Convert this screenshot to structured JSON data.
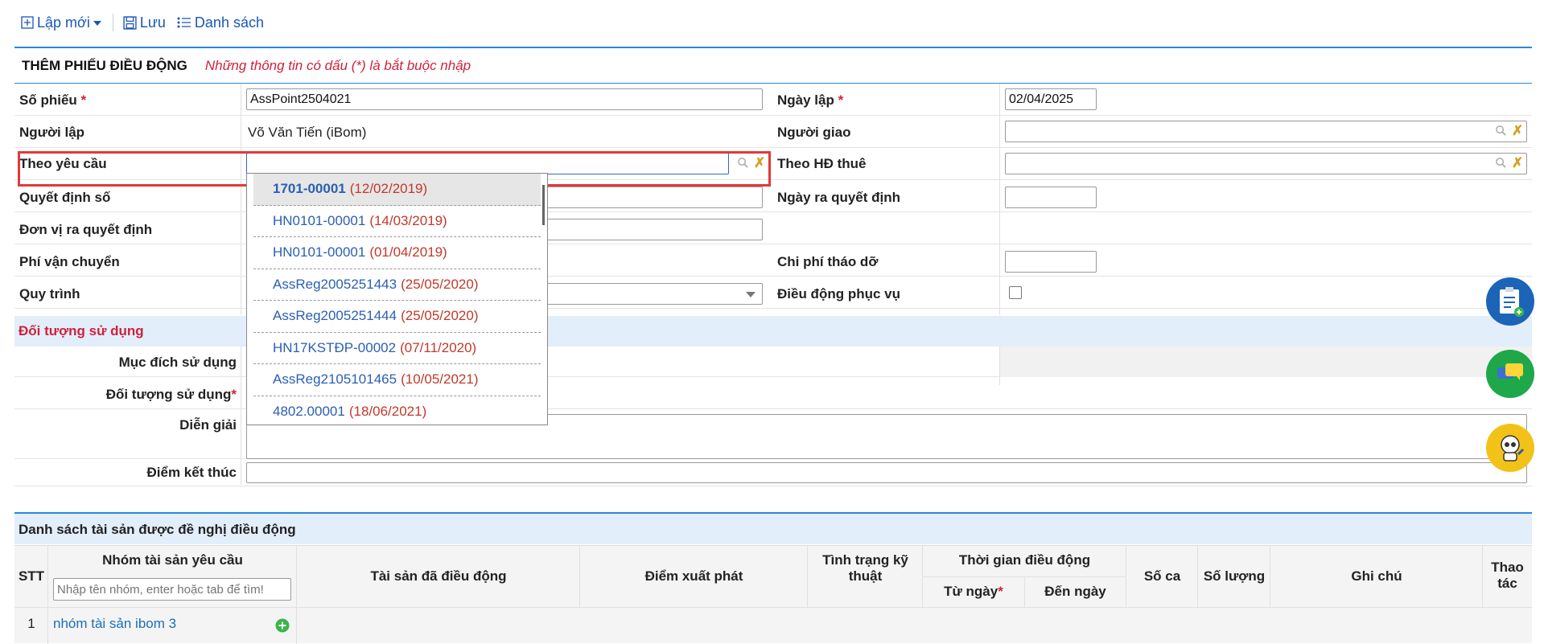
{
  "toolbar": {
    "new_label": "Lập mới",
    "save_label": "Lưu",
    "list_label": "Danh sách"
  },
  "form": {
    "title": "THÊM PHIẾU ĐIỀU ĐỘNG",
    "note": "Những thông tin có dấu (*) là bắt buộc nhập",
    "so_phieu_label": "Số phiếu",
    "so_phieu_value": "AssPoint2504021",
    "ngay_lap_label": "Ngày lập",
    "ngay_lap_value": "02/04/2025",
    "nguoi_lap_label": "Người lập",
    "nguoi_lap_value": "Võ Văn Tiến (iBom)",
    "nguoi_giao_label": "Người giao",
    "theo_yeu_cau_label": "Theo yêu cầu",
    "theo_hd_thue_label": "Theo HĐ thuê",
    "quyet_dinh_so_label": "Quyết định số",
    "ngay_ra_qd_label": "Ngày ra quyết định",
    "don_vi_label": "Đơn vị ra quyết định",
    "phi_van_chuyen_label": "Phí vận chuyển",
    "chi_phi_thao_do_label": "Chi phí tháo dỡ",
    "quy_trinh_label": "Quy trình",
    "dieu_dong_phuc_vu_label": "Điều động phục vụ",
    "required_mark": "*"
  },
  "section_doi_tuong": {
    "title": "Đối tượng sử dụng",
    "muc_dich_label": "Mục đích sử dụng",
    "doi_tuong_label": "Đối tượng sử dụng",
    "dien_giai_label": "Diễn giải",
    "diem_ket_thuc_label": "Điểm kết thúc"
  },
  "dropdown": {
    "items": [
      {
        "code": "1701-00001",
        "date": "(12/02/2019)"
      },
      {
        "code": "HN0101-00001",
        "date": "(14/03/2019)"
      },
      {
        "code": "HN0101-00001",
        "date": "(01/04/2019)"
      },
      {
        "code": "AssReg2005251443",
        "date": "(25/05/2020)"
      },
      {
        "code": "AssReg2005251444",
        "date": "(25/05/2020)"
      },
      {
        "code": "HN17KSTĐP-00002",
        "date": "(07/11/2020)"
      },
      {
        "code": "AssReg2105101465",
        "date": "(10/05/2021)"
      },
      {
        "code": "4802.00001",
        "date": "(18/06/2021)"
      }
    ]
  },
  "assets": {
    "title": "Danh sách tài sản được đề nghị điều động",
    "col_stt": "STT",
    "col_nhom": "Nhóm tài sản yêu cầu",
    "col_nhom_placeholder": "Nhập tên nhóm, enter hoặc tab để tìm!",
    "col_tai_san": "Tài sản đã điều động",
    "col_diem_xuat_phat": "Điểm xuất phát",
    "col_tinh_trang_1": "Tình trạng kỹ",
    "col_tinh_trang_2": "thuật",
    "col_thoi_gian": "Thời gian điều động",
    "col_tu_ngay": "Từ ngày",
    "col_den_ngay": "Đến ngày",
    "col_so_ca": "Số ca",
    "col_so_luong": "Số lượng",
    "col_ghi_chu": "Ghi chú",
    "col_thao_1": "Thao",
    "col_thao_2": "tác",
    "rows": [
      {
        "stt": "1",
        "nhom": "nhóm tài sản ibom 3"
      }
    ]
  },
  "colors": {
    "accent": "#2a88d8",
    "link": "#1a56b8",
    "required": "#d0213c",
    "section_bg": "#e3eefb"
  }
}
